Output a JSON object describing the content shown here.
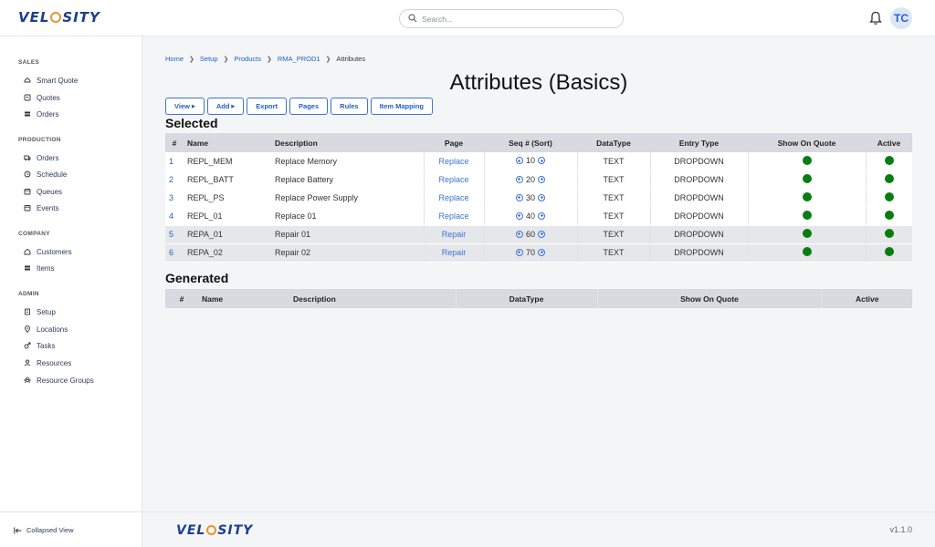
{
  "header": {
    "logo_text": "VELOSITY",
    "search_placeholder": "Search...",
    "avatar_initials": "TC"
  },
  "sidebar": {
    "sections": [
      {
        "title": "SALES",
        "items": [
          {
            "label": "Smart Quote",
            "icon": "cloud-icon"
          },
          {
            "label": "Quotes",
            "icon": "document-icon"
          },
          {
            "label": "Orders",
            "icon": "stack-icon"
          }
        ]
      },
      {
        "title": "PRODUCTION",
        "items": [
          {
            "label": "Orders",
            "icon": "truck-icon"
          },
          {
            "label": "Schedule",
            "icon": "clock-icon"
          },
          {
            "label": "Queues",
            "icon": "calendar-icon"
          },
          {
            "label": "Events",
            "icon": "calendar-icon"
          }
        ]
      },
      {
        "title": "COMPANY",
        "items": [
          {
            "label": "Customers",
            "icon": "home-icon"
          },
          {
            "label": "Items",
            "icon": "stack-icon"
          }
        ]
      },
      {
        "title": "ADMIN",
        "items": [
          {
            "label": "Setup",
            "icon": "building-icon"
          },
          {
            "label": "Locations",
            "icon": "pin-icon"
          },
          {
            "label": "Tasks",
            "icon": "gender-icon"
          },
          {
            "label": "Resources",
            "icon": "person-icon"
          },
          {
            "label": "Resource Groups",
            "icon": "group-icon"
          }
        ]
      }
    ],
    "collapse_label": "Collapsed View"
  },
  "breadcrumb": {
    "items": [
      "Home",
      "Setup",
      "Products",
      "RMA_PROD1"
    ],
    "current": "Attributes"
  },
  "page_title": "Attributes (Basics)",
  "toolbar": {
    "view": "View",
    "add": "Add",
    "export": "Export",
    "pages": "Pages",
    "rules": "Rules",
    "item_mapping": "Item Mapping"
  },
  "selected": {
    "heading": "Selected",
    "columns": [
      "#",
      "Name",
      "Description",
      "Page",
      "Seq # (Sort)",
      "DataType",
      "Entry Type",
      "Show On Quote",
      "Active"
    ],
    "rows": [
      {
        "num": "1",
        "name": "REPL_MEM",
        "description": "Replace Memory",
        "page": "Replace",
        "seq": "10",
        "datatype": "TEXT",
        "entry_type": "DROPDOWN",
        "show_on_quote": true,
        "active": true
      },
      {
        "num": "2",
        "name": "REPL_BATT",
        "description": "Replace Battery",
        "page": "Replace",
        "seq": "20",
        "datatype": "TEXT",
        "entry_type": "DROPDOWN",
        "show_on_quote": true,
        "active": true
      },
      {
        "num": "3",
        "name": "REPL_PS",
        "description": "Replace Power Supply",
        "page": "Replace",
        "seq": "30",
        "datatype": "TEXT",
        "entry_type": "DROPDOWN",
        "show_on_quote": true,
        "active": true
      },
      {
        "num": "4",
        "name": "REPL_01",
        "description": "Replace 01",
        "page": "Replace",
        "seq": "40",
        "datatype": "TEXT",
        "entry_type": "DROPDOWN",
        "show_on_quote": true,
        "active": true
      },
      {
        "num": "5",
        "name": "REPA_01",
        "description": "Repair 01",
        "page": "Repair",
        "seq": "60",
        "datatype": "TEXT",
        "entry_type": "DROPDOWN",
        "show_on_quote": true,
        "active": true
      },
      {
        "num": "6",
        "name": "REPA_02",
        "description": "Repair 02",
        "page": "Repair",
        "seq": "70",
        "datatype": "TEXT",
        "entry_type": "DROPDOWN",
        "show_on_quote": true,
        "active": true
      }
    ]
  },
  "generated": {
    "heading": "Generated",
    "columns": [
      "#",
      "Name",
      "Description",
      "DataType",
      "Show On Quote",
      "Active"
    ]
  },
  "footer": {
    "logo_text": "VELOSITY",
    "version": "v1.1.0"
  },
  "colors": {
    "accent": "#1f5fd1",
    "status_active": "#0a7d12",
    "logo_orange": "#e8952e",
    "logo_navy": "#1d3f8c"
  }
}
